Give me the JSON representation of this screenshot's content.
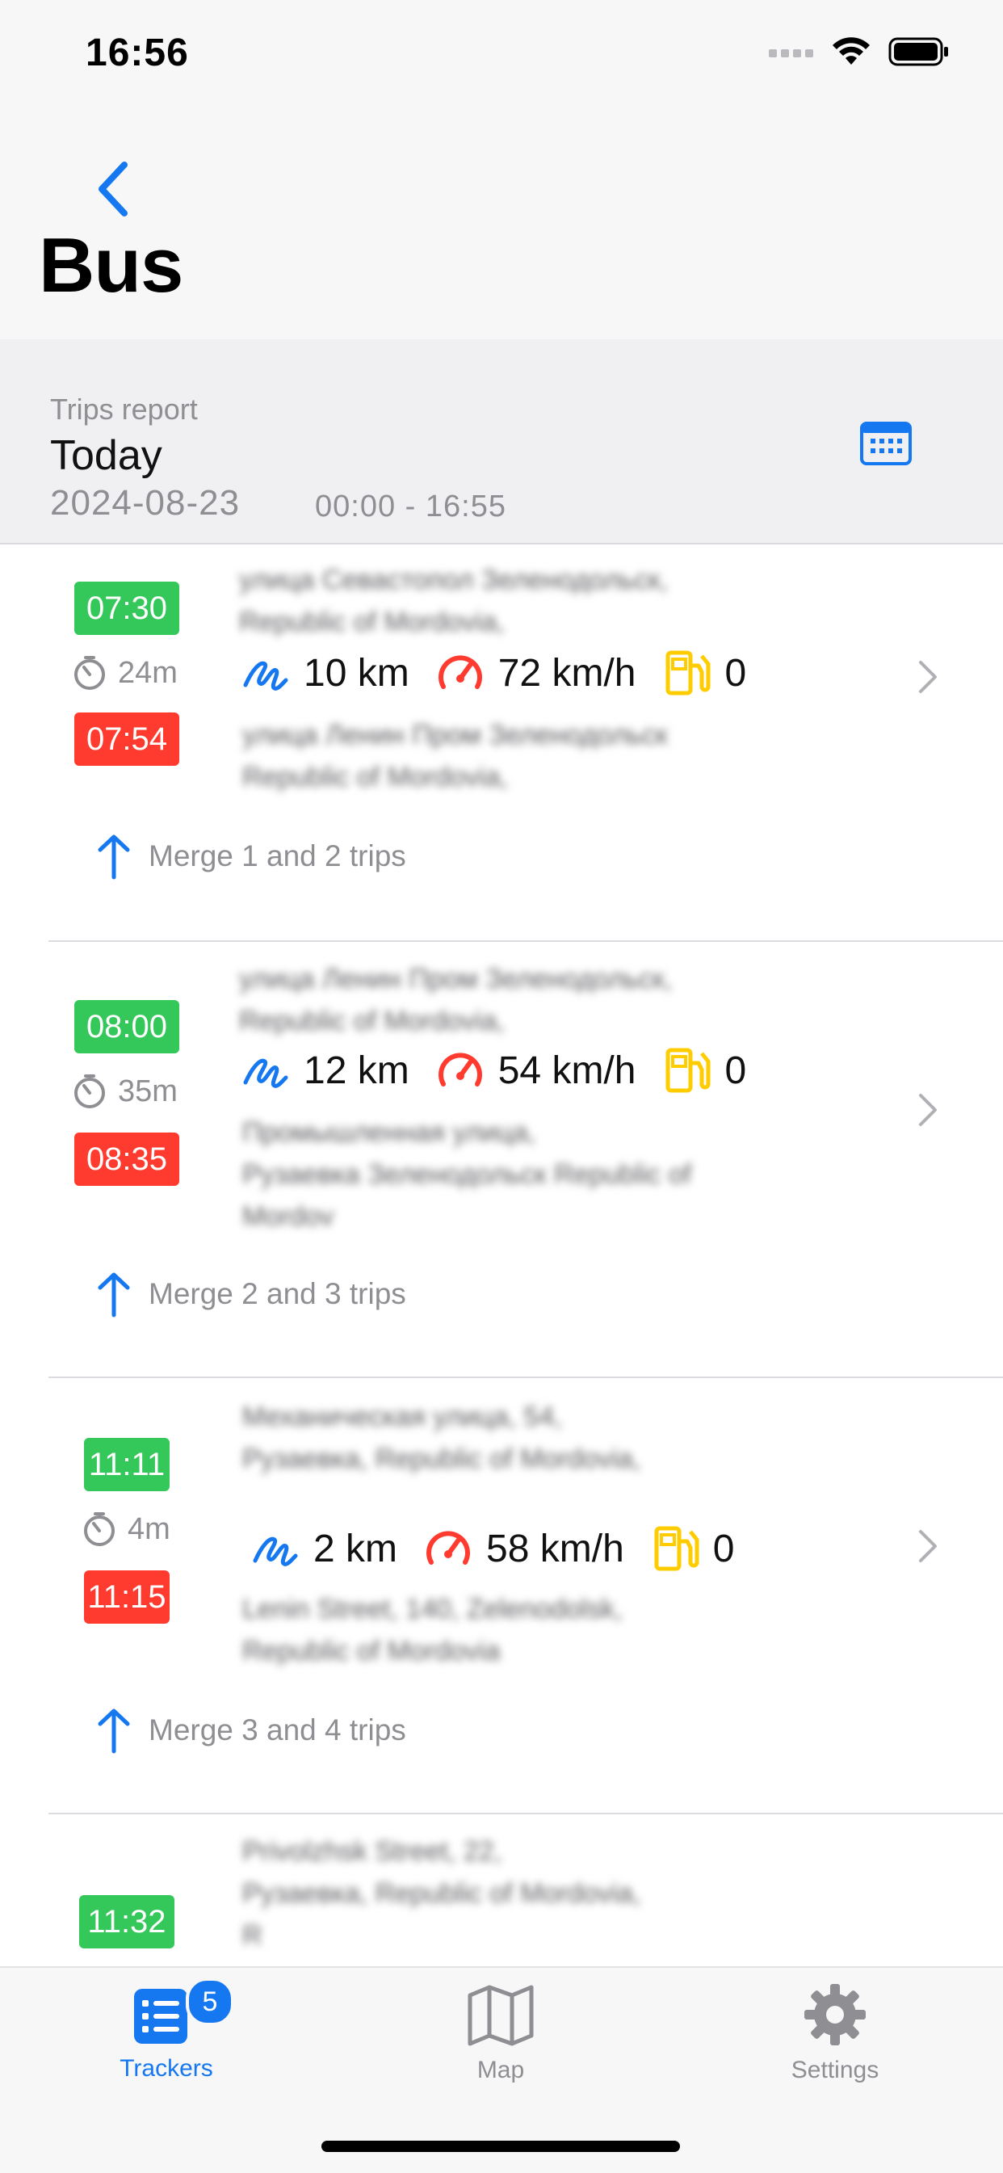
{
  "status_bar": {
    "time": "16:56"
  },
  "nav": {
    "title": "Bus"
  },
  "report": {
    "label": "Trips report",
    "period": "Today",
    "date": "2024-08-23",
    "hours": "00:00 - 16:55"
  },
  "colors": {
    "accent": "#1678f0",
    "start": "#34c759",
    "end": "#ff3b30",
    "fuel": "#ffcc00"
  },
  "trips": [
    {
      "start": "07:30",
      "end": "07:54",
      "duration": "24m",
      "from": [
        "улица Севастопол Зеленодольск,",
        "Republic of Mordovia,"
      ],
      "to": [
        "улица Ленин Пром Зеленодольск",
        "Republic of Mordovia,"
      ],
      "distance": "10 km",
      "speed": "72 km/h",
      "fuel": "0",
      "merge": "Merge 1 and 2 trips"
    },
    {
      "start": "08:00",
      "end": "08:35",
      "duration": "35m",
      "from": [
        "улица Ленин Пром Зеленодольск,",
        "Republic of Mordovia,"
      ],
      "to": [
        "Промышленная улица,",
        "Рузаевка Зеленодольск Republic of",
        "Mordov"
      ],
      "distance": "12 km",
      "speed": "54 km/h",
      "fuel": "0",
      "merge": "Merge 2 and 3 trips"
    },
    {
      "start": "11:11",
      "end": "11:15",
      "duration": "4m",
      "from": [
        "Механическая улица, 54,",
        "Рузаевка, Republic of Mordovia,"
      ],
      "to": [
        "Lenin Street, 140, Zelenodolsk,",
        "Republic of Mordovia"
      ],
      "distance": "2 km",
      "speed": "58 km/h",
      "fuel": "0",
      "merge": "Merge 3 and 4 trips"
    },
    {
      "start": "11:32",
      "from": [
        "Privolzhsk Street, 22,",
        "Рузаевка, Republic of Mordovia,",
        "R"
      ]
    }
  ],
  "tabbar": {
    "tabs": [
      {
        "label": "Trackers",
        "badge": "5"
      },
      {
        "label": "Map"
      },
      {
        "label": "Settings"
      }
    ]
  }
}
